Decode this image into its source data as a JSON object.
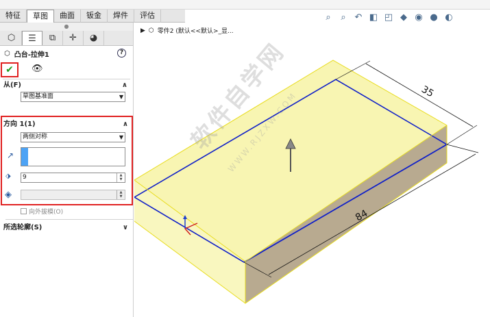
{
  "command_tabs": [
    "特征",
    "草图",
    "曲面",
    "钣金",
    "焊件",
    "评估"
  ],
  "active_tab_index": 1,
  "panel": {
    "feature_title": "凸台-拉伸1",
    "help_label": "?",
    "from_label": "从(F)",
    "from_value": "草图基准面",
    "direction_label": "方向 1(1)",
    "direction_type": "两侧对称",
    "depth_value": "9",
    "draft_label": "向外拔模(O)",
    "contours_label": "所选轮廓(S)"
  },
  "tree": {
    "label": "零件2 (默认<<默认>_显..."
  },
  "model": {
    "dim_width": "35",
    "dim_length": "84",
    "face_color": "#f7f3a4",
    "edge_color": "#e8dc1e",
    "sketch_color": "#1020c8",
    "side_color": "#b8aa90"
  },
  "watermark": {
    "text": "软件自学网",
    "sub": "WWW.RJZXW.COM"
  }
}
